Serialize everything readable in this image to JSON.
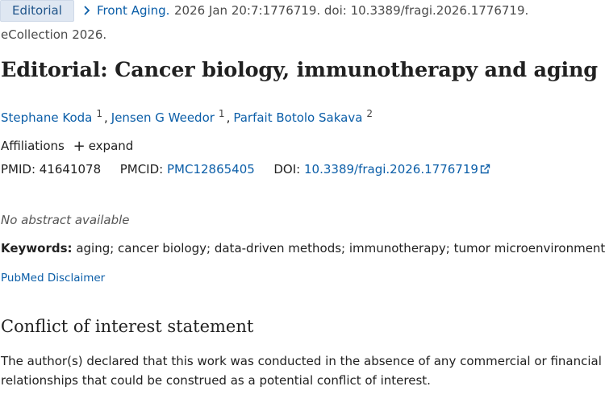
{
  "citation": {
    "publication_type": "Editorial",
    "journal": "Front Aging.",
    "details": "2026 Jan 20:7:1776719. doi: 10.3389/fragi.2026.1776719.",
    "ecollection": "eCollection 2026."
  },
  "article": {
    "title": "Editorial: Cancer biology, immunotherapy and aging"
  },
  "authors": [
    {
      "name": "Stephane Koda",
      "affiliation": "1"
    },
    {
      "name": "Jensen G Weedor",
      "affiliation": "1"
    },
    {
      "name": "Parfait Botolo Sakava",
      "affiliation": "2"
    }
  ],
  "affiliations": {
    "label": "Affiliations",
    "expand_label": "expand"
  },
  "identifiers": {
    "pmid_label": "PMID:",
    "pmid": "41641078",
    "pmcid_label": "PMCID:",
    "pmcid": "PMC12865405",
    "doi_label": "DOI:",
    "doi": "10.3389/fragi.2026.1776719"
  },
  "abstract": {
    "text": "No abstract available"
  },
  "keywords": {
    "label": "Keywords:",
    "text": "aging; cancer biology; data-driven methods; immunotherapy; tumor microenvironment."
  },
  "disclaimer": {
    "label": "PubMed Disclaimer"
  },
  "conflict_of_interest": {
    "heading": "Conflict of interest statement",
    "text": "The author(s) declared that this work was conducted in the absence of any commercial or financial relationships that could be construed as a potential conflict of interest."
  },
  "icons": {
    "chevron": "chevron-right-icon",
    "plus": "plus-icon",
    "external_link": "external-link-icon"
  },
  "colors": {
    "link": "#0b5ea8",
    "badge_bg": "#dfe7f2",
    "text": "#212121"
  }
}
